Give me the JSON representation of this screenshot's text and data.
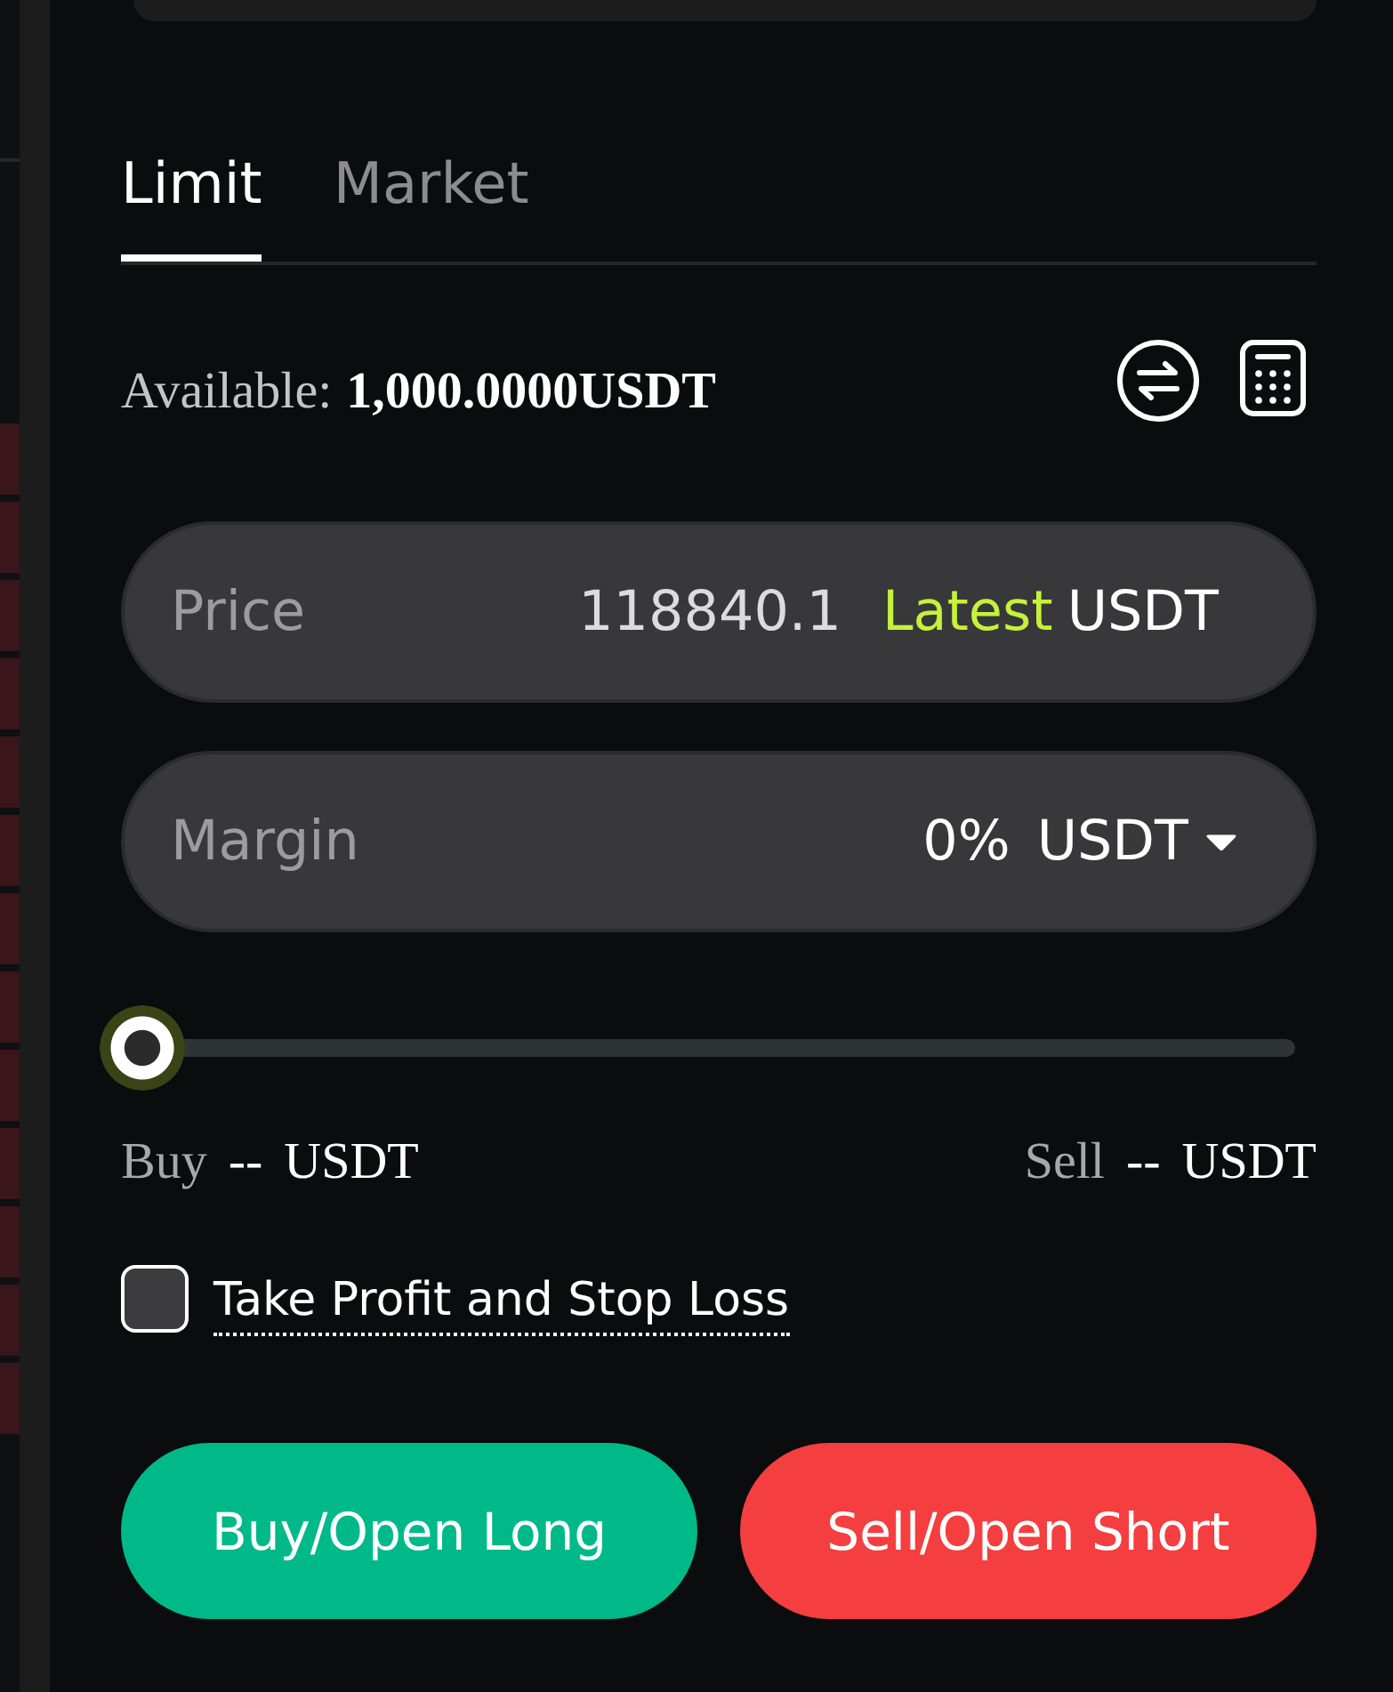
{
  "order_book": {
    "rows": [
      {
        "kind": "ask"
      },
      {
        "kind": "ask"
      },
      {
        "kind": "ask"
      },
      {
        "kind": "ask"
      },
      {
        "kind": "ask"
      },
      {
        "kind": "ask"
      },
      {
        "kind": "ask"
      },
      {
        "kind": "ask"
      },
      {
        "kind": "ask"
      },
      {
        "kind": "ask"
      },
      {
        "kind": "ask"
      },
      {
        "kind": "ask"
      },
      {
        "kind": "ask"
      }
    ]
  },
  "tabs": [
    {
      "label": "Limit",
      "selected": true
    },
    {
      "label": "Market",
      "selected": false
    }
  ],
  "available": {
    "label": "Available:",
    "value": "1,000.0000USDT"
  },
  "price_field": {
    "label": "Price",
    "value": "118840.1",
    "latest_button": "Latest",
    "unit": "USDT"
  },
  "margin_field": {
    "label": "Margin",
    "value": "0%",
    "unit": "USDT"
  },
  "slider": {
    "level": 0
  },
  "amounts": [
    {
      "label": "Buy",
      "value": "--",
      "unit": "USDT"
    },
    {
      "label": "Sell",
      "value": "--",
      "unit": "USDT"
    }
  ],
  "tpsl": {
    "label": "Take Profit and Stop Loss",
    "checked": false
  },
  "actions": [
    {
      "label": "Buy/Open Long",
      "kind": "buy"
    },
    {
      "label": "Sell/Open Short",
      "kind": "sell"
    }
  ]
}
